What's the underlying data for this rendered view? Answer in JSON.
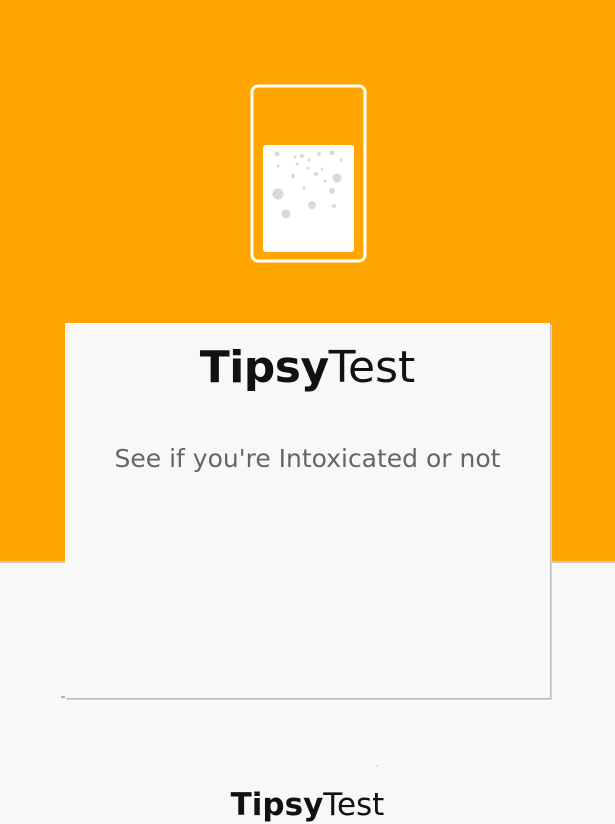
{
  "logo": {
    "icon": "beer-glass-icon",
    "accent": "#ffa700",
    "glass_color": "#ffffff",
    "bubble_color": "#d9d9d9"
  },
  "card": {
    "title_bold": "Tipsy",
    "title_rest": "Test",
    "tagline": "See if you're Intoxicated or not"
  },
  "footer": {
    "title_bold": "Tipsy",
    "title_rest": "Test"
  },
  "colors": {
    "header_background": "#ffa700",
    "page_background": "#f8f8f8",
    "card_background": "#f8f8f8"
  }
}
